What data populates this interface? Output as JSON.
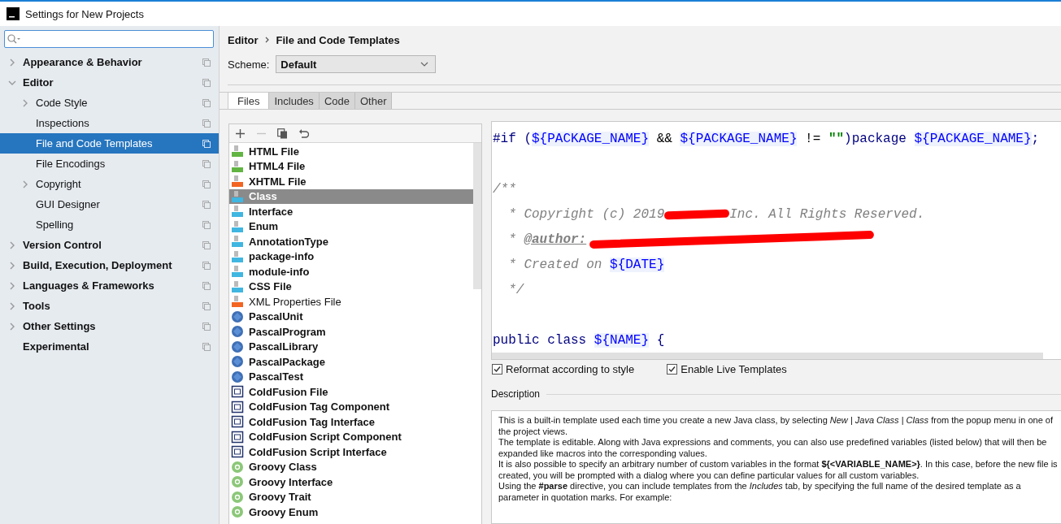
{
  "window": {
    "title": "Settings for New Projects"
  },
  "sidebar": {
    "items": [
      {
        "label": "Appearance & Behavior",
        "expanded": false,
        "selected": false
      },
      {
        "label": "Editor",
        "expanded": true,
        "selected": false,
        "children": [
          {
            "label": "Code Style",
            "expanded": false,
            "selected": false
          },
          {
            "label": "Inspections",
            "selected": false
          },
          {
            "label": "File and Code Templates",
            "selected": true
          },
          {
            "label": "File Encodings",
            "selected": false
          },
          {
            "label": "Copyright",
            "expanded": false,
            "selected": false
          },
          {
            "label": "GUI Designer",
            "selected": false
          },
          {
            "label": "Spelling",
            "selected": false
          }
        ]
      },
      {
        "label": "Version Control",
        "expanded": false,
        "selected": false
      },
      {
        "label": "Build, Execution, Deployment",
        "expanded": false,
        "selected": false
      },
      {
        "label": "Languages & Frameworks",
        "expanded": false,
        "selected": false
      },
      {
        "label": "Tools",
        "expanded": false,
        "selected": false
      },
      {
        "label": "Other Settings",
        "expanded": false,
        "selected": false
      },
      {
        "label": "Experimental",
        "selected": false
      }
    ]
  },
  "breadcrumb": [
    "Editor",
    "File and Code Templates"
  ],
  "scheme": {
    "label": "Scheme:",
    "value": "Default"
  },
  "tabs": [
    {
      "label": "Files",
      "selected": true
    },
    {
      "label": "Includes",
      "selected": false
    },
    {
      "label": "Code",
      "selected": false
    },
    {
      "label": "Other",
      "selected": false
    }
  ],
  "toolbar": [
    {
      "kind": "plus",
      "disabled": false
    },
    {
      "kind": "minus",
      "disabled": true
    },
    {
      "kind": "copy",
      "disabled": false
    },
    {
      "kind": "revert",
      "disabled": false
    }
  ],
  "templates": [
    {
      "label": "HTML File",
      "kind": "html",
      "bold": true,
      "selected": false
    },
    {
      "label": "HTML4 File",
      "kind": "html",
      "bold": true,
      "selected": false
    },
    {
      "label": "XHTML File",
      "kind": "xhtml",
      "bold": true,
      "selected": false
    },
    {
      "label": "Class",
      "kind": "java",
      "bold": true,
      "selected": true
    },
    {
      "label": "Interface",
      "kind": "java",
      "bold": true,
      "selected": false
    },
    {
      "label": "Enum",
      "kind": "java",
      "bold": true,
      "selected": false
    },
    {
      "label": "AnnotationType",
      "kind": "java",
      "bold": true,
      "selected": false
    },
    {
      "label": "package-info",
      "kind": "java",
      "bold": true,
      "selected": false
    },
    {
      "label": "module-info",
      "kind": "java",
      "bold": true,
      "selected": false
    },
    {
      "label": "CSS File",
      "kind": "css",
      "bold": true,
      "selected": false
    },
    {
      "label": "XML Properties File",
      "kind": "xml",
      "bold": false,
      "selected": false
    },
    {
      "label": "PascalUnit",
      "kind": "pascal",
      "bold": true,
      "selected": false
    },
    {
      "label": "PascalProgram",
      "kind": "pascal",
      "bold": true,
      "selected": false
    },
    {
      "label": "PascalLibrary",
      "kind": "pascal",
      "bold": true,
      "selected": false
    },
    {
      "label": "PascalPackage",
      "kind": "pascal",
      "bold": true,
      "selected": false
    },
    {
      "label": "PascalTest",
      "kind": "pascal",
      "bold": true,
      "selected": false
    },
    {
      "label": "ColdFusion File",
      "kind": "coldfusion",
      "bold": true,
      "selected": false
    },
    {
      "label": "ColdFusion Tag Component",
      "kind": "coldfusion",
      "bold": true,
      "selected": false
    },
    {
      "label": "ColdFusion Tag Interface",
      "kind": "coldfusion",
      "bold": true,
      "selected": false
    },
    {
      "label": "ColdFusion Script Component",
      "kind": "coldfusion",
      "bold": true,
      "selected": false
    },
    {
      "label": "ColdFusion Script Interface",
      "kind": "coldfusion",
      "bold": true,
      "selected": false
    },
    {
      "label": "Groovy Class",
      "kind": "groovy",
      "bold": true,
      "selected": false
    },
    {
      "label": "Groovy Interface",
      "kind": "groovy",
      "bold": true,
      "selected": false
    },
    {
      "label": "Groovy Trait",
      "kind": "groovy",
      "bold": true,
      "selected": false
    },
    {
      "label": "Groovy Enum",
      "kind": "groovy",
      "bold": true,
      "selected": false
    }
  ],
  "editor": {
    "lines": [
      {
        "kind": "code",
        "tokens": [
          {
            "kind": "keyword",
            "text": "#if ("
          },
          {
            "kind": "var",
            "text": "${PACKAGE_NAME}"
          },
          {
            "kind": "plain",
            "text": " && "
          },
          {
            "kind": "var",
            "text": "${PACKAGE_NAME}"
          },
          {
            "kind": "plain",
            "text": " != "
          },
          {
            "kind": "string",
            "text": "\"\""
          },
          {
            "kind": "keyword",
            "text": ")package "
          },
          {
            "kind": "var",
            "text": "${PACKAGE_NAME}"
          },
          {
            "kind": "keyword",
            "text": ";"
          }
        ]
      },
      {
        "kind": "blank"
      },
      {
        "kind": "code",
        "tokens": [
          {
            "kind": "comment",
            "text": "/**"
          }
        ]
      },
      {
        "kind": "code",
        "tokens": [
          {
            "kind": "comment",
            "text": "  * Copyright (c) 2019"
          },
          {
            "kind": "redaction"
          },
          {
            "kind": "comment",
            "text": "Inc. All Rights Reserved."
          }
        ]
      },
      {
        "kind": "code",
        "tokens": [
          {
            "kind": "comment",
            "text": "  * "
          },
          {
            "kind": "tag",
            "text": "@author:"
          },
          {
            "kind": "redaction"
          }
        ]
      },
      {
        "kind": "code",
        "tokens": [
          {
            "kind": "comment",
            "text": "  * Created on "
          },
          {
            "kind": "var",
            "text": "${DATE}"
          }
        ]
      },
      {
        "kind": "code",
        "tokens": [
          {
            "kind": "comment",
            "text": "  */"
          }
        ]
      },
      {
        "kind": "blank"
      },
      {
        "kind": "code",
        "tokens": [
          {
            "kind": "keyword",
            "text": "public class "
          },
          {
            "kind": "var",
            "text": "${NAME}"
          },
          {
            "kind": "keyword",
            "text": " {"
          }
        ]
      }
    ]
  },
  "options": [
    {
      "label": "Reformat according to style",
      "checked": true
    },
    {
      "label": "Enable Live Templates",
      "checked": true
    }
  ],
  "description": {
    "title": "Description",
    "paragraphs": [
      "This is a built-in template used each time you create a new Java class, by selecting *New* | *Java Class* | *Class* from the popup menu in one of the project views.",
      "The template is editable. Along with Java expressions and comments, you can also use predefined variables (listed below) that will then be expanded like macros into the corresponding values.",
      "It is also possible to specify an arbitrary number of custom variables in the format **${<VARIABLE_NAME>}**. In this case, before the new file is created, you will be prompted with a dialog where you can define particular values for all custom variables.",
      "Using the **#parse** directive, you can include templates from the *Includes* tab, by specifying the full name of the desired template as a parameter in quotation marks. For example:"
    ]
  }
}
